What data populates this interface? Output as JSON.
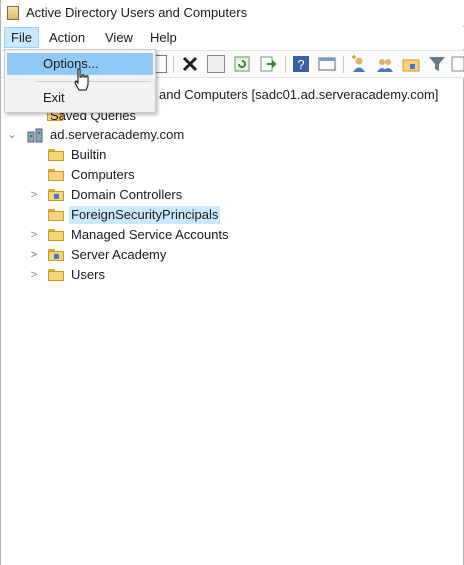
{
  "window": {
    "title": "Active Directory Users and Computers"
  },
  "menubar": {
    "items": [
      "File",
      "Action",
      "View",
      "Help"
    ]
  },
  "file_menu": {
    "options_label": "Options...",
    "exit_label": "Exit"
  },
  "tree": {
    "root_label": "Active Directory Users and Computers [sadc01.ad.serveracademy.com]",
    "root_visible_suffix": "and Computers [sadc01.ad.serveracademy.com]",
    "saved_queries": "Saved Queries",
    "domain": "ad.serveracademy.com",
    "children": [
      {
        "label": "Builtin",
        "expandable": false,
        "type": "container"
      },
      {
        "label": "Computers",
        "expandable": false,
        "type": "container"
      },
      {
        "label": "Domain Controllers",
        "expandable": true,
        "type": "ou"
      },
      {
        "label": "ForeignSecurityPrincipals",
        "expandable": false,
        "type": "container",
        "selected": true
      },
      {
        "label": "Managed Service Accounts",
        "expandable": true,
        "type": "container"
      },
      {
        "label": "Server Academy",
        "expandable": true,
        "type": "ou"
      },
      {
        "label": "Users",
        "expandable": true,
        "type": "container"
      }
    ]
  },
  "toolbar_icons": [
    "cut-icon",
    "delete-icon",
    "properties-icon",
    "refresh-icon",
    "export-list-icon",
    "help-icon",
    "console-tree-icon",
    "new-user-icon",
    "new-group-icon",
    "new-ou-icon",
    "filter-icon",
    "find-icon"
  ],
  "colors": {
    "selection": "#cce8ff",
    "menu_hover": "#91c9f7",
    "folder": "#f6d37a"
  }
}
